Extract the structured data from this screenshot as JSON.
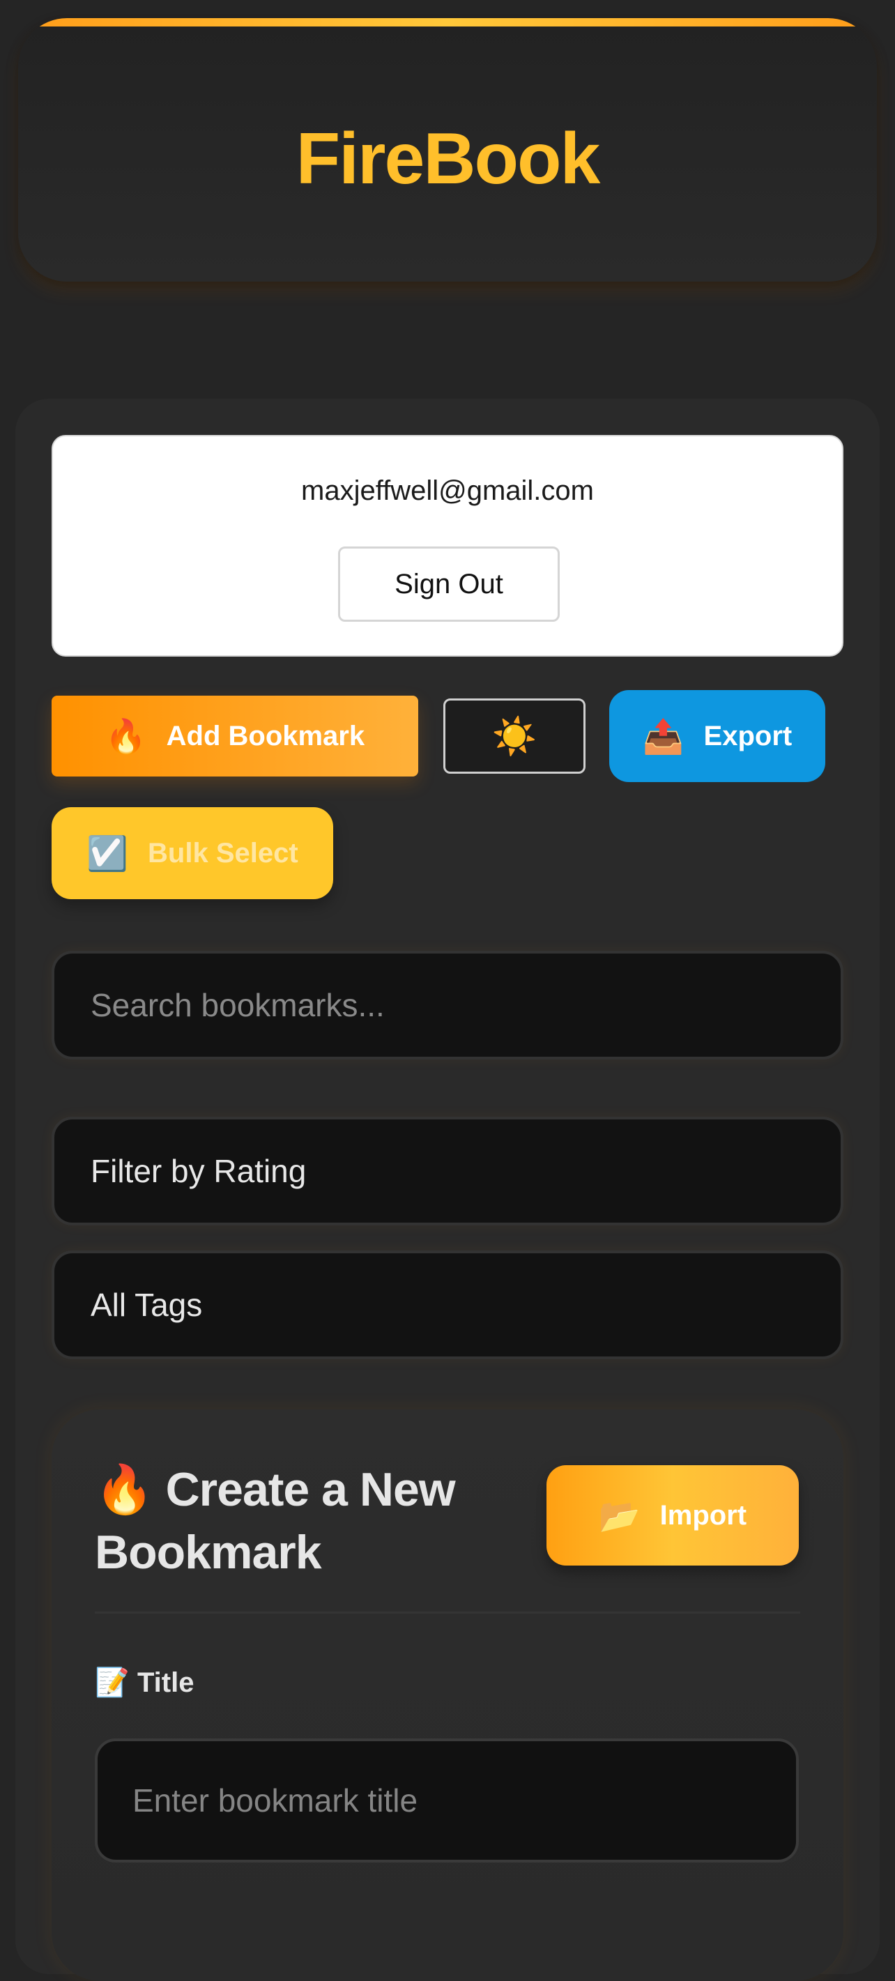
{
  "header": {
    "title": "FireBook"
  },
  "user": {
    "email": "maxjeffwell@gmail.com",
    "sign_out_label": "Sign Out"
  },
  "toolbar": {
    "add_icon": "🔥",
    "add_label": "Add Bookmark",
    "theme_icon": "☀️",
    "export_icon": "📤",
    "export_label": "Export",
    "bulk_icon": "☑️",
    "bulk_label": "Bulk Select"
  },
  "search": {
    "placeholder": "Search bookmarks..."
  },
  "filters": {
    "rating_label": "Filter by Rating",
    "tags_label": "All Tags"
  },
  "create": {
    "title_icon": "🔥",
    "title": "Create a New Bookmark",
    "import_icon": "📂",
    "import_label": "Import",
    "field_label_icon": "📝",
    "field_label": "Title",
    "title_placeholder": "Enter bookmark title"
  },
  "colors": {
    "accent": "#ffbf2b",
    "export": "#0e97e0",
    "bulk": "#ffc72a",
    "background": "#252525"
  }
}
